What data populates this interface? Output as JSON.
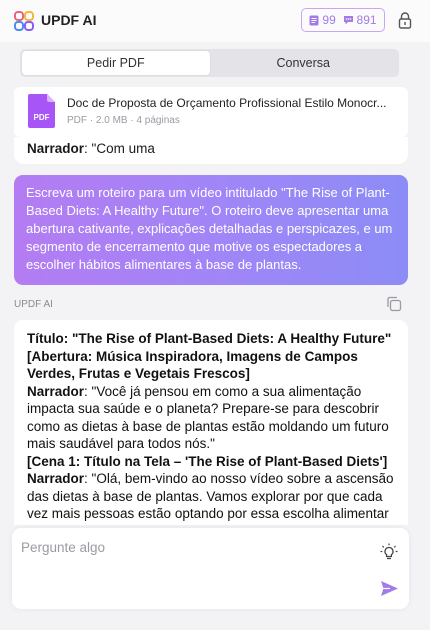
{
  "header": {
    "title": "UPDF AI",
    "credits": {
      "docs": "99",
      "chat": "891"
    },
    "accent": "#a27be6"
  },
  "tabs": [
    {
      "label": "Pedir PDF",
      "active": true
    },
    {
      "label": "Conversa",
      "active": false
    }
  ],
  "file": {
    "name": "Doc de Proposta de Orçamento Profissional Estilo Monocr...",
    "meta": "PDF · 2.0 MB · 4 páginas",
    "icon_label": "PDF"
  },
  "previous": {
    "speaker": "Narrador",
    "text": ": \"Com uma"
  },
  "prompt": "Escreva um roteiro para um vídeo intitulado \"The Rise of Plant-Based Diets: A Healthy Future\". O roteiro deve apresentar uma abertura cativante, explicações detalhadas e perspicazes, e um segmento de encerramento que motive os espectadores a escolher hábitos alimentares à base de plantas.",
  "ai_label": "UPDF AI",
  "response": {
    "title": "Título: \"The Rise of Plant-Based Diets: A Healthy Future\"",
    "opening": "[Abertura: Música Inspiradora, Imagens de Campos Verdes, Frutas e Vegetais Frescos]",
    "narrator1_label": "Narrador",
    "narrator1_text": ": \"Você já pensou em como a sua alimentação impacta sua saúde e o planeta? Prepare-se para descobrir como as dietas à base de plantas estão moldando um futuro mais saudável para todos nós.\"",
    "scene1": "[Cena 1: Título na Tela – 'The Rise of Plant-Based Diets']",
    "narrator2_label": "Narrador",
    "narrator2_text": ": \"Olá, bem-vindo ao nosso vídeo sobre a ascensão das dietas à base de plantas. Vamos explorar por que cada vez mais pessoas estão optando por essa escolha alimentar e os"
  },
  "input": {
    "placeholder": "Pergunte algo",
    "value": ""
  },
  "colors": {
    "gradient_start": "#b47cf2",
    "gradient_end": "#8c8cf6",
    "pdf_icon": "#a855f7"
  }
}
